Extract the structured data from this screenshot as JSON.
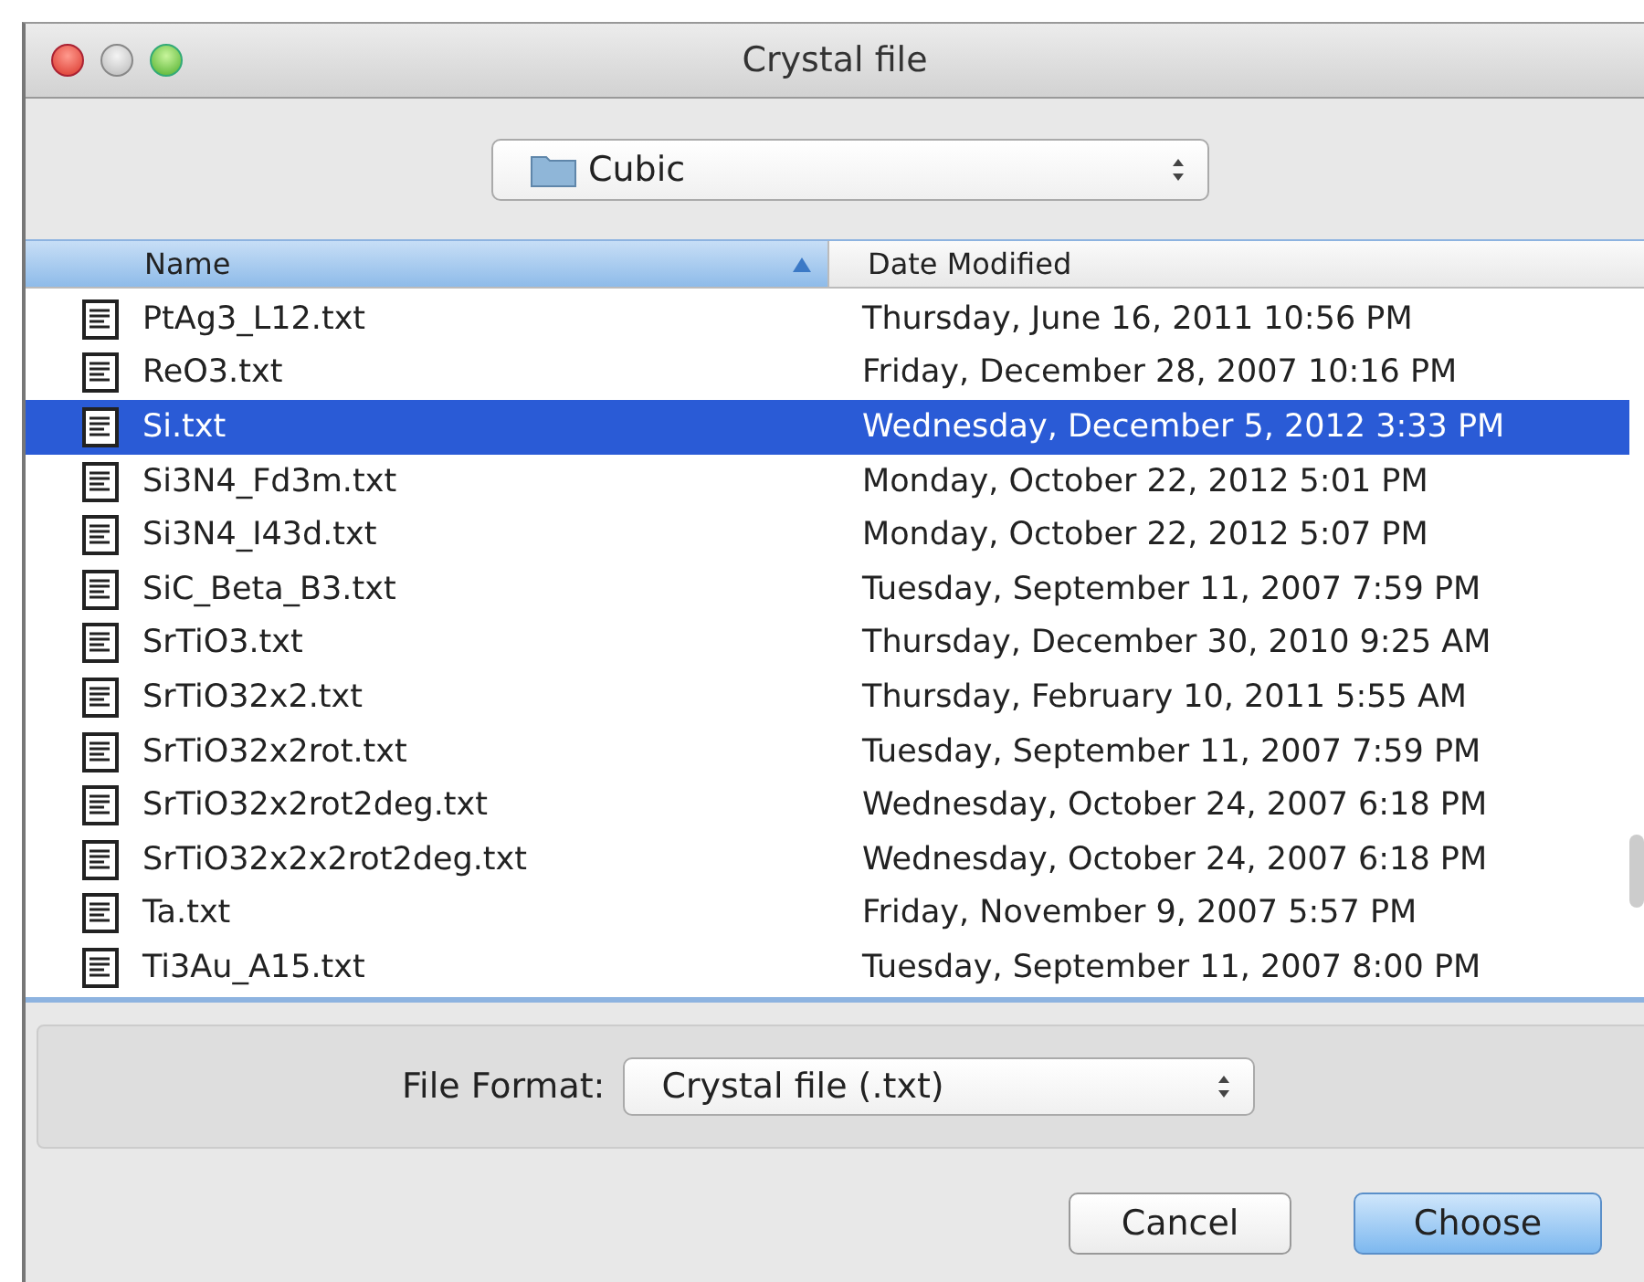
{
  "window": {
    "title": "Crystal file"
  },
  "location": {
    "value": "Cubic"
  },
  "table": {
    "columns": [
      {
        "label": "Name",
        "sorted": true
      },
      {
        "label": "Date Modified",
        "sorted": false
      }
    ],
    "rows": [
      {
        "name": "PtAg3_L12.txt",
        "date": "Thursday, June 16, 2011 10:56 PM",
        "selected": false
      },
      {
        "name": "ReO3.txt",
        "date": "Friday, December 28, 2007 10:16 PM",
        "selected": false
      },
      {
        "name": "Si.txt",
        "date": "Wednesday, December 5, 2012 3:33 PM",
        "selected": true
      },
      {
        "name": "Si3N4_Fd3m.txt",
        "date": "Monday, October 22, 2012 5:01 PM",
        "selected": false
      },
      {
        "name": "Si3N4_I43d.txt",
        "date": "Monday, October 22, 2012 5:07 PM",
        "selected": false
      },
      {
        "name": "SiC_Beta_B3.txt",
        "date": "Tuesday, September 11, 2007 7:59 PM",
        "selected": false
      },
      {
        "name": "SrTiO3.txt",
        "date": "Thursday, December 30, 2010 9:25 AM",
        "selected": false
      },
      {
        "name": "SrTiO32x2.txt",
        "date": "Thursday, February 10, 2011 5:55 AM",
        "selected": false
      },
      {
        "name": "SrTiO32x2rot.txt",
        "date": "Tuesday, September 11, 2007 7:59 PM",
        "selected": false
      },
      {
        "name": "SrTiO32x2rot2deg.txt",
        "date": "Wednesday, October 24, 2007 6:18 PM",
        "selected": false
      },
      {
        "name": "SrTiO32x2x2rot2deg.txt",
        "date": "Wednesday, October 24, 2007 6:18 PM",
        "selected": false
      },
      {
        "name": "Ta.txt",
        "date": "Friday, November 9, 2007 5:57 PM",
        "selected": false
      },
      {
        "name": "Ti3Au_A15.txt",
        "date": "Tuesday, September 11, 2007 8:00 PM",
        "selected": false
      }
    ]
  },
  "format": {
    "label": "File Format:",
    "value": "Crystal file (.txt)"
  },
  "buttons": [
    {
      "label": "Cancel",
      "default": false
    },
    {
      "label": "Choose",
      "default": true
    }
  ]
}
